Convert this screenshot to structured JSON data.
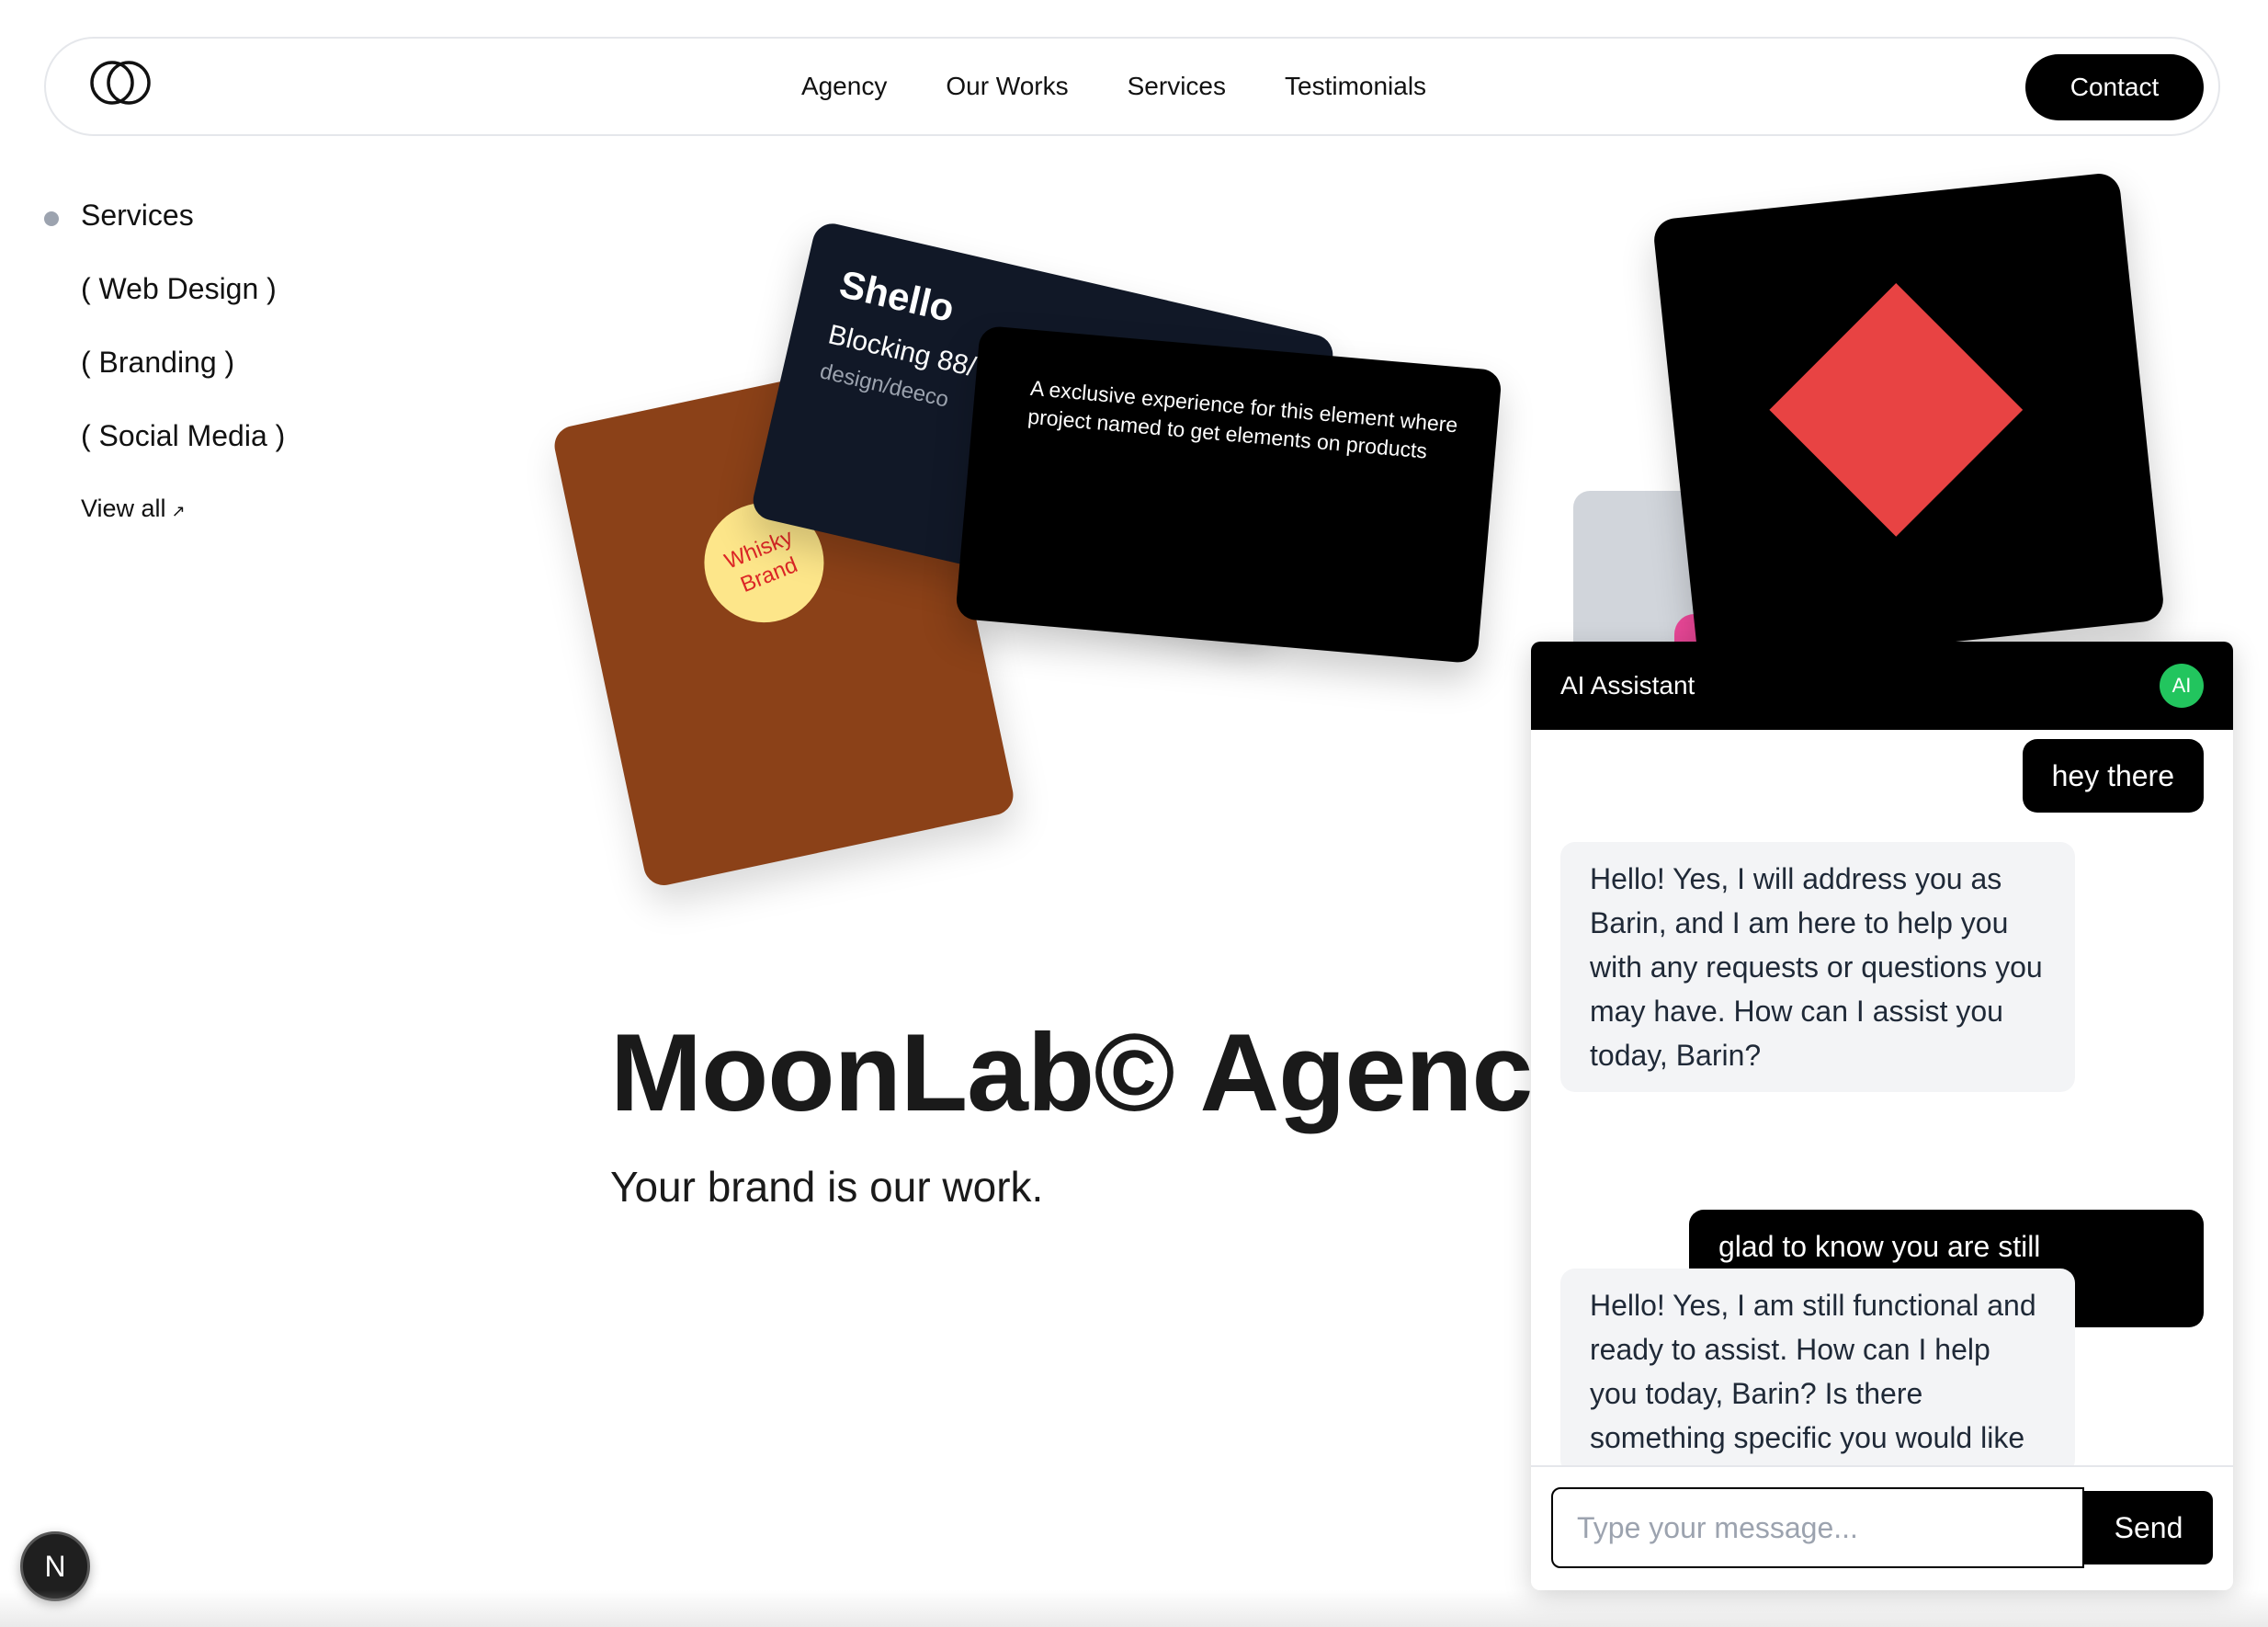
{
  "header": {
    "nav": [
      "Agency",
      "Our Works",
      "Services",
      "Testimonials"
    ],
    "contact_label": "Contact"
  },
  "sidebar": {
    "title": "Services",
    "items": [
      "( Web Design )",
      "( Branding )",
      "( Social Media )"
    ],
    "view_all": "View all",
    "view_all_arrow": "↗"
  },
  "cards": {
    "navy_title": "Shello",
    "navy_subtitle": "Blocking 88/",
    "navy_meta": "design/deeco",
    "black_text": "A exclusive experience for this element where project named to get elements on products",
    "sticker_line1": "Whisky",
    "sticker_line2": "Brand"
  },
  "hero": {
    "title": "MoonLab© Agency",
    "subtitle": "Your brand is our work."
  },
  "chat": {
    "title": "AI Assistant",
    "avatar": "AI",
    "messages": [
      {
        "role": "user",
        "text": "hey there"
      },
      {
        "role": "assistant",
        "text": "Hello! Yes, I will address you as Barin, and I am here to help you with any requests or questions you may have. How can I assist you today, Barin?"
      },
      {
        "role": "user",
        "text": "glad to know you are still functional"
      },
      {
        "role": "assistant",
        "text": "Hello! Yes, I am still functional and ready to assist. How can I help you today, Barin? Is there something specific you would like"
      }
    ],
    "input_placeholder": "Type your message...",
    "send_label": "Send"
  },
  "badge": {
    "label": "N"
  },
  "colors": {
    "brown_card": "#8b4118",
    "navy_card": "#111827",
    "diamond": "#e84343",
    "sticker": "#fde68a",
    "avatar": "#22c55e",
    "pink_accent": "#ec4899"
  }
}
